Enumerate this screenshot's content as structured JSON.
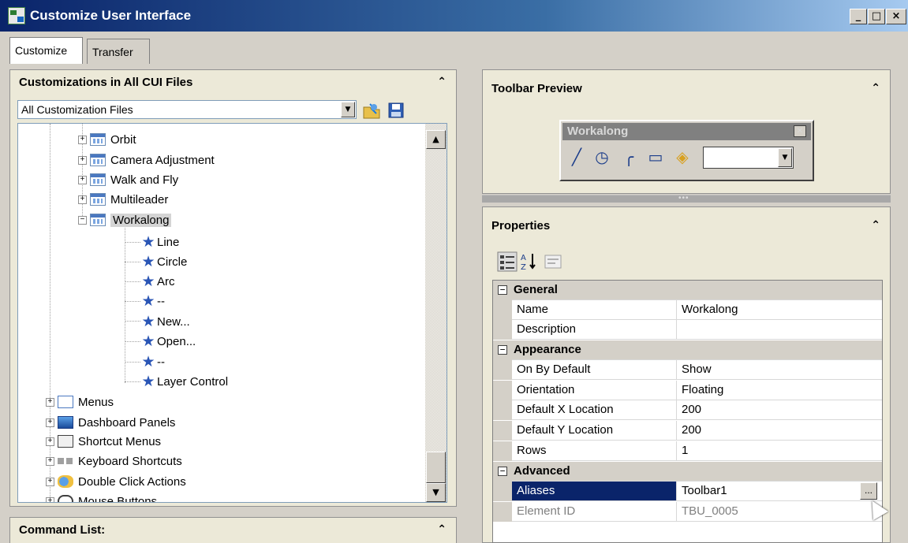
{
  "window": {
    "title": "Customize User Interface",
    "minimize": "_",
    "maximize": "□",
    "close": "×"
  },
  "tabs": [
    "Customize",
    "Transfer"
  ],
  "left_panel": {
    "title": "Customizations in All CUI Files",
    "combo_value": "All Customization Files",
    "tree": {
      "toolbars": [
        "Orbit",
        "Camera Adjustment",
        "Walk and Fly",
        "Multileader",
        "Workalong"
      ],
      "workalong_items": [
        "Line",
        "Circle",
        "Arc",
        "--",
        "New...",
        "Open...",
        "--",
        "Layer Control"
      ],
      "groups": [
        "Menus",
        "Dashboard Panels",
        "Shortcut Menus",
        "Keyboard Shortcuts",
        "Double Click Actions",
        "Mouse Buttons"
      ]
    }
  },
  "command_list": {
    "title": "Command List:"
  },
  "toolbar_preview": {
    "title": "Toolbar Preview",
    "toolbar_name": "Workalong"
  },
  "properties": {
    "title": "Properties",
    "categories": [
      {
        "name": "General",
        "rows": [
          {
            "name": "Name",
            "value": "Workalong"
          },
          {
            "name": "Description",
            "value": ""
          }
        ]
      },
      {
        "name": "Appearance",
        "rows": [
          {
            "name": "On By Default",
            "value": "Show"
          },
          {
            "name": "Orientation",
            "value": "Floating"
          },
          {
            "name": "Default X Location",
            "value": "200"
          },
          {
            "name": "Default Y Location",
            "value": "200"
          },
          {
            "name": "Rows",
            "value": "1"
          }
        ]
      },
      {
        "name": "Advanced",
        "rows": [
          {
            "name": "Aliases",
            "value": "Toolbar1"
          },
          {
            "name": "Element ID",
            "value": "TBU_0005"
          }
        ]
      }
    ]
  }
}
